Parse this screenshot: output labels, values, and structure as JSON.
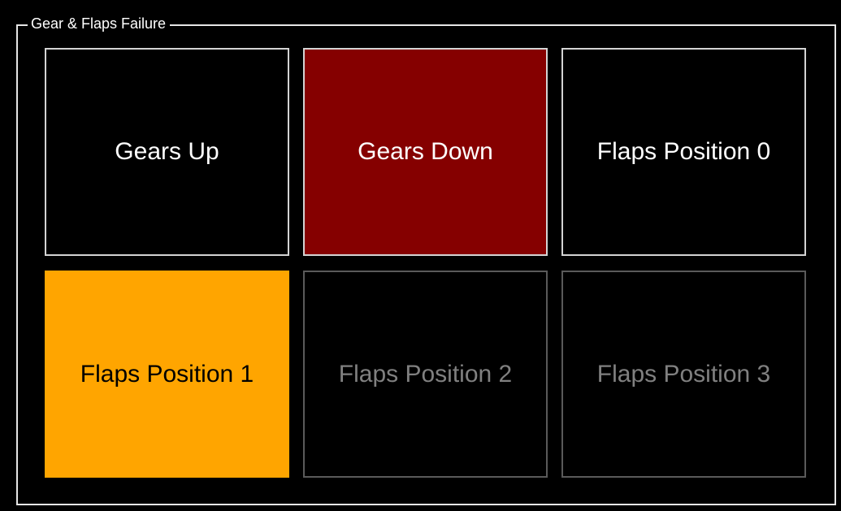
{
  "panel": {
    "title": "Gear & Flaps Failure"
  },
  "buttons": [
    {
      "label": "Gears Up",
      "state": "normal",
      "bg": "#000000",
      "fg": "#ffffff"
    },
    {
      "label": "Gears Down",
      "state": "active",
      "bg": "#850000",
      "fg": "#ffffff"
    },
    {
      "label": "Flaps Position 0",
      "state": "normal",
      "bg": "#000000",
      "fg": "#ffffff"
    },
    {
      "label": "Flaps Position 1",
      "state": "warning",
      "bg": "#ffa500",
      "fg": "#000000"
    },
    {
      "label": "Flaps Position 2",
      "state": "disabled",
      "bg": "#000000",
      "fg": "#808080"
    },
    {
      "label": "Flaps Position 3",
      "state": "disabled",
      "bg": "#000000",
      "fg": "#808080"
    }
  ]
}
